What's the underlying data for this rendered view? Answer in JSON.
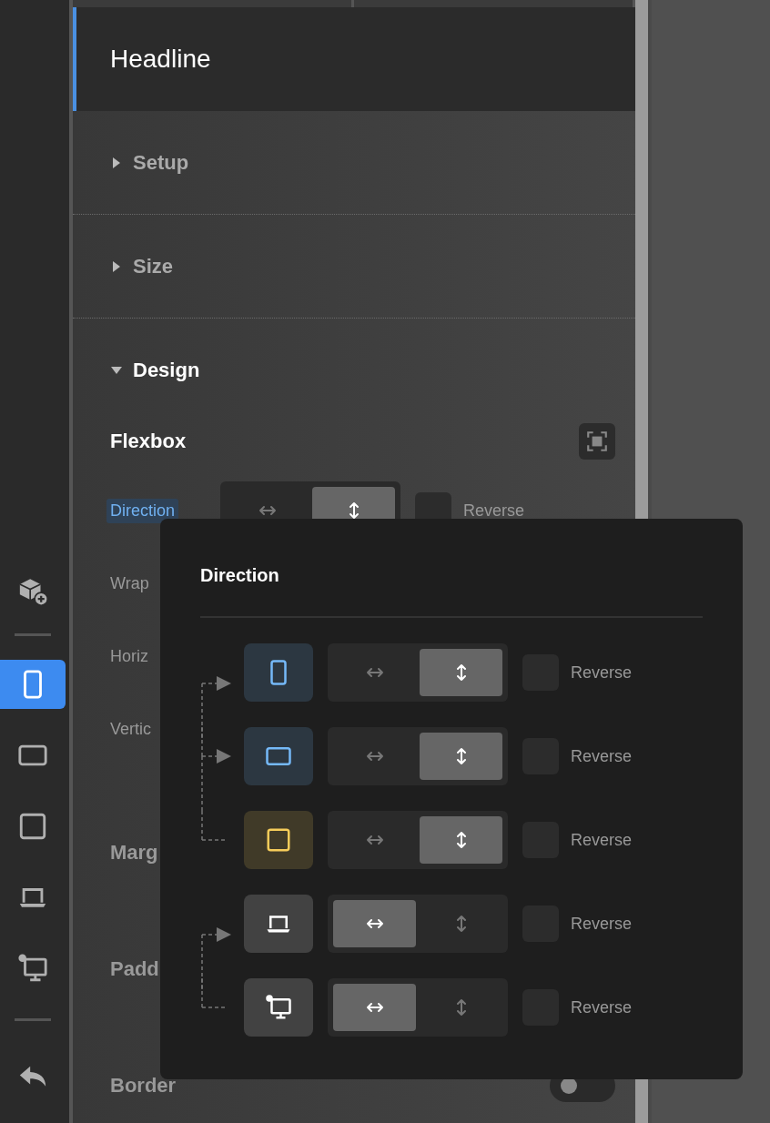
{
  "toolbar": [
    {
      "kind": "add-component"
    },
    {
      "kind": "divider"
    },
    {
      "kind": "tablet-portrait",
      "selected": true
    },
    {
      "kind": "tablet-landscape",
      "selected": false
    },
    {
      "kind": "square",
      "selected": false
    },
    {
      "kind": "laptop",
      "selected": false
    },
    {
      "kind": "desktop",
      "selected": false
    },
    {
      "kind": "divider"
    },
    {
      "kind": "undo"
    }
  ],
  "panel": {
    "title": "Headline",
    "sections": [
      {
        "label": "Setup",
        "expanded": false
      },
      {
        "label": "Size",
        "expanded": false
      },
      {
        "label": "Design",
        "expanded": true
      }
    ],
    "flexbox": {
      "title": "Flexbox"
    },
    "properties": [
      {
        "kind": "direction",
        "label": "Direction",
        "selected": true,
        "options": [
          {
            "kind": "horizontal",
            "selected": false
          },
          {
            "kind": "vertical",
            "selected": true
          }
        ],
        "reverse": {
          "label": "Reverse",
          "checked": false
        }
      },
      {
        "kind": "plain",
        "label": "Wrap",
        "selected": false
      },
      {
        "kind": "plain",
        "label": "Horiz",
        "selected": false
      },
      {
        "kind": "plain",
        "label": "Vertic",
        "selected": false
      },
      {
        "kind": "group",
        "label": "Marg"
      },
      {
        "kind": "group",
        "label": "Padd"
      },
      {
        "kind": "toggle",
        "label": "Border",
        "on": false
      }
    ]
  },
  "popover": {
    "title": "Direction",
    "rows": [
      {
        "kind": "tablet-portrait",
        "color": "#75b9f8",
        "linked_up": false,
        "arrow": true,
        "options": [
          {
            "kind": "horizontal",
            "selected": false
          },
          {
            "kind": "vertical",
            "selected": true
          }
        ],
        "reverse": {
          "label": "Reverse",
          "checked": false
        }
      },
      {
        "kind": "tablet-landscape",
        "color": "#75b9f8",
        "linked_up": true,
        "arrow": true,
        "options": [
          {
            "kind": "horizontal",
            "selected": false
          },
          {
            "kind": "vertical",
            "selected": true
          }
        ],
        "reverse": {
          "label": "Reverse",
          "checked": false
        }
      },
      {
        "kind": "square",
        "color": "#f5cc5a",
        "linked_up": true,
        "arrow": false,
        "options": [
          {
            "kind": "horizontal",
            "selected": false
          },
          {
            "kind": "vertical",
            "selected": true
          }
        ],
        "reverse": {
          "label": "Reverse",
          "checked": false
        }
      },
      {
        "kind": "laptop",
        "color": "#ffffff",
        "linked_up": false,
        "arrow": true,
        "options": [
          {
            "kind": "horizontal",
            "selected": true
          },
          {
            "kind": "vertical",
            "selected": false
          }
        ],
        "reverse": {
          "label": "Reverse",
          "checked": false
        }
      },
      {
        "kind": "desktop",
        "color": "#ffffff",
        "linked_up": true,
        "arrow": false,
        "options": [
          {
            "kind": "horizontal",
            "selected": true
          },
          {
            "kind": "vertical",
            "selected": false
          }
        ],
        "reverse": {
          "label": "Reverse",
          "checked": false
        }
      }
    ]
  }
}
